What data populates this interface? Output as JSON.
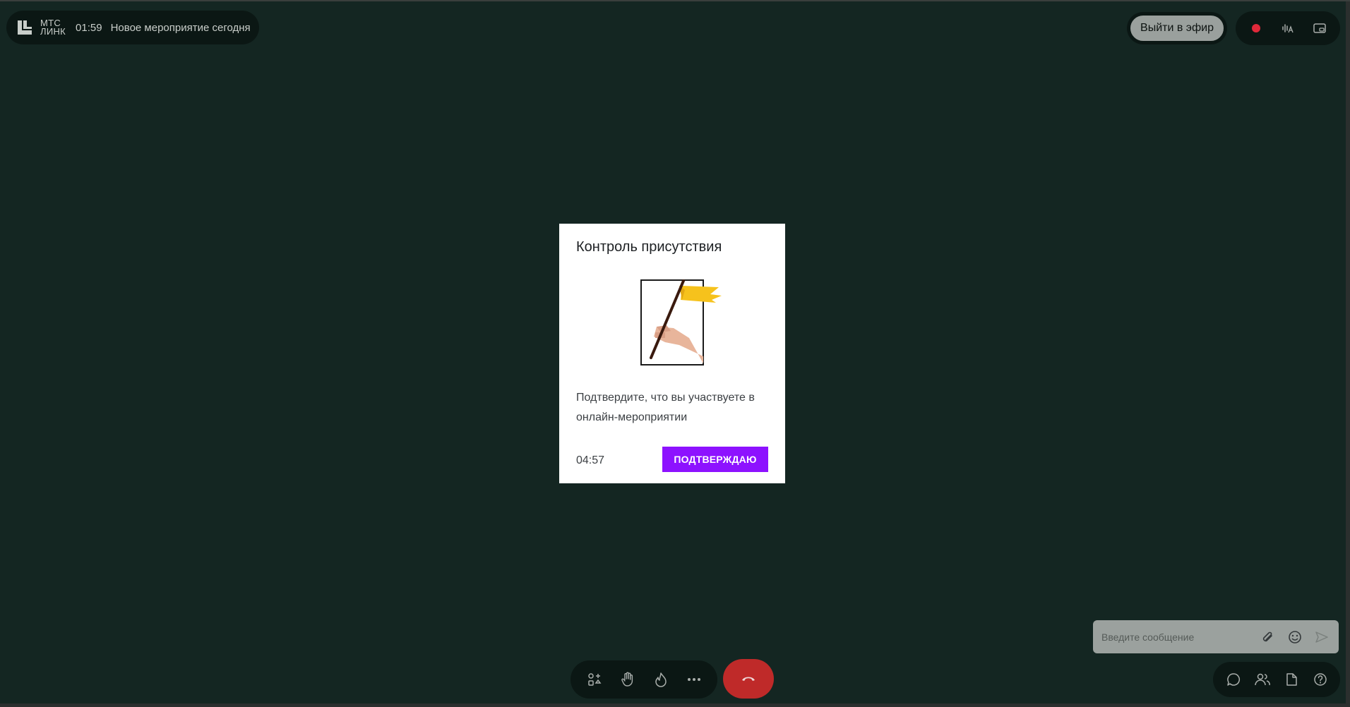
{
  "header": {
    "logo_line1": "МТС",
    "logo_line2": "ЛИНК",
    "timer": "01:59",
    "event_title": "Новое мероприятие сегодня"
  },
  "top_right": {
    "go_live_label": "Выйти в эфир",
    "icons": [
      "record-icon",
      "noise-reduction-icon",
      "picture-in-picture-icon"
    ]
  },
  "modal": {
    "title": "Контроль присутствия",
    "message": "Подтвердите, что вы участвуете в онлайн-мероприятии",
    "countdown": "04:57",
    "confirm_label": "ПОДТВЕРЖДАЮ"
  },
  "chat": {
    "placeholder": "Введите сообщение",
    "icons": [
      "attach-icon",
      "emoji-icon",
      "send-icon"
    ]
  },
  "bottom_toolbar": {
    "icons": [
      "add-apps-icon",
      "raise-hand-icon",
      "reaction-icon",
      "more-icon",
      "hang-up-icon"
    ]
  },
  "bottom_right_toolbar": {
    "icons": [
      "chat-icon",
      "participants-icon",
      "materials-icon",
      "help-icon"
    ]
  },
  "colors": {
    "background": "#142622",
    "accent": "#8d12ff",
    "hangup": "#bf2a29",
    "record": "#e0293a"
  }
}
